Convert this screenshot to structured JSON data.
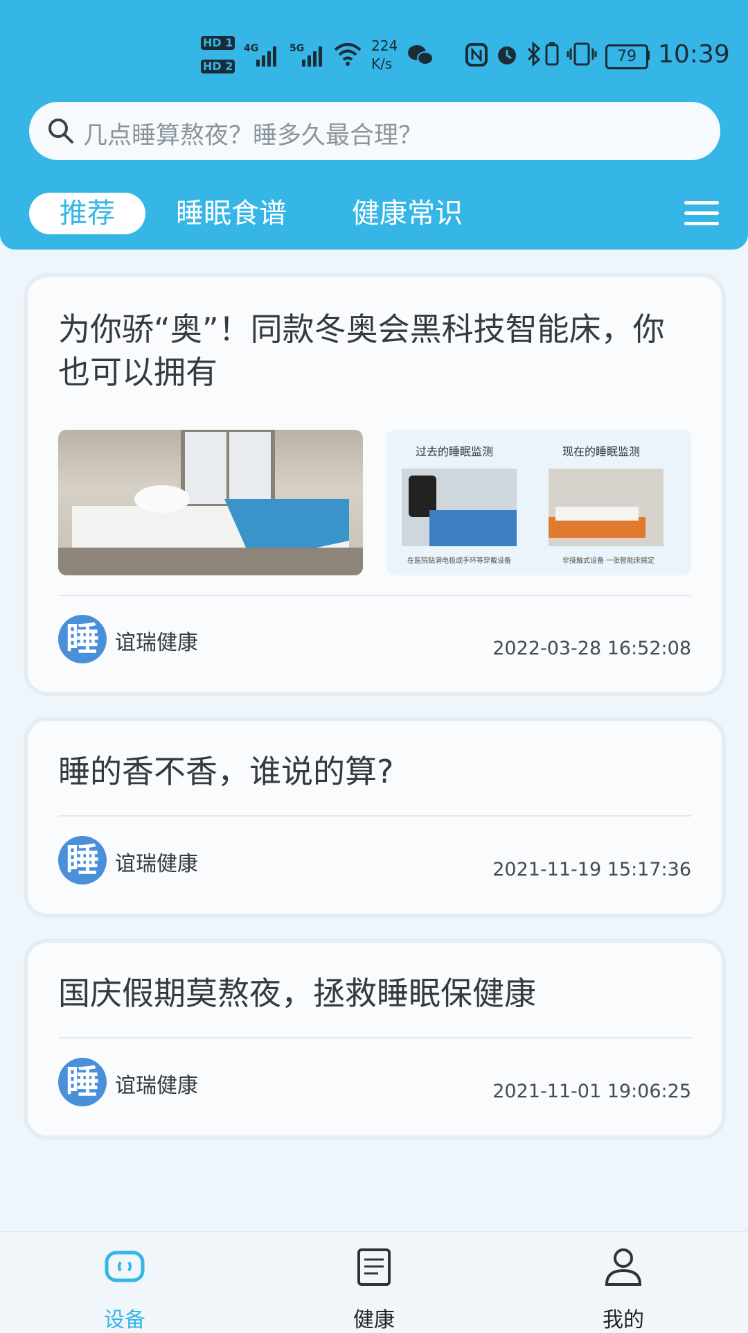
{
  "status_bar": {
    "hd1": "HD 1",
    "hd2": "HD 2",
    "net1": "4G",
    "net2": "5G",
    "speed_value": "224",
    "speed_unit": "K/s",
    "battery": "79",
    "time": "10:39"
  },
  "search": {
    "placeholder": "几点睡算熬夜？睡多久最合理？"
  },
  "tabs": [
    {
      "label": "推荐",
      "active": true
    },
    {
      "label": "睡眠食谱",
      "active": false
    },
    {
      "label": "健康常识",
      "active": false
    }
  ],
  "articles": [
    {
      "title": "为你骄“奥”！同款冬奥会黑科技智能床，你也可以拥有",
      "thumb2": {
        "left_label": "过去的睡眠监测",
        "right_label": "现在的睡眠监测",
        "left_caption": "在医院贴满电极或手环等穿戴设备",
        "right_caption": "非接触式设备 一张智能床搞定"
      },
      "author": "谊瑞健康",
      "avatar_char": "睡",
      "date": "2022-03-28 16:52:08"
    },
    {
      "title": "睡的香不香，谁说的算?",
      "author": "谊瑞健康",
      "avatar_char": "睡",
      "date": "2021-11-19 15:17:36"
    },
    {
      "title": "国庆假期莫熬夜，拯救睡眠保健康",
      "author": "谊瑞健康",
      "avatar_char": "睡",
      "date": "2021-11-01 19:06:25"
    }
  ],
  "bottom_nav": [
    {
      "label": "设备",
      "icon": "device-icon",
      "active": true
    },
    {
      "label": "健康",
      "icon": "document-icon",
      "active": false
    },
    {
      "label": "我的",
      "icon": "user-icon",
      "active": false
    }
  ],
  "colors": {
    "primary": "#35b6e6",
    "avatar": "#4a90d9",
    "background": "#eef5fb"
  }
}
